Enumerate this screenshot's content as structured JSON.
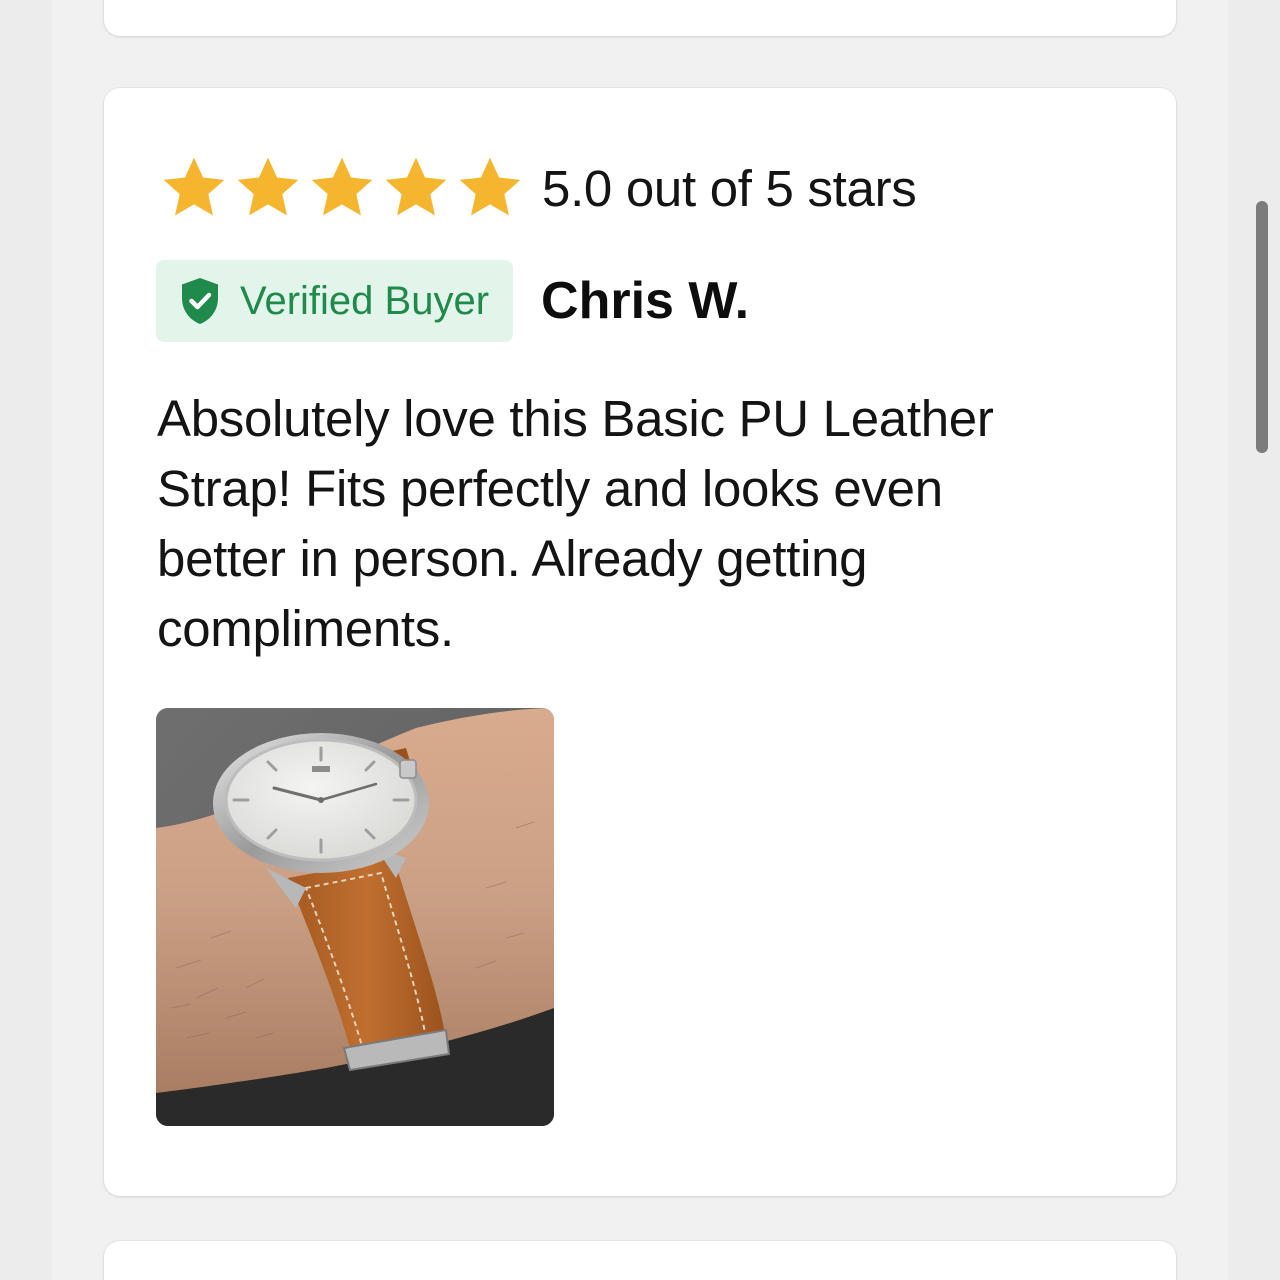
{
  "review": {
    "rating": 5,
    "rating_text": "5.0 out of 5 stars",
    "star_color": "#F5B52E",
    "verified_label": "Verified Buyer",
    "verified_color": "#1F8A4C",
    "reviewer_name": "Chris W.",
    "body": "Absolutely love this Basic PU Leather Strap! Fits perfectly and looks even better in person. Already getting compliments.",
    "photo_icon": "wristwatch-leather-strap-photo"
  },
  "scrollbar": {
    "icon": "scrollbar-thumb"
  }
}
